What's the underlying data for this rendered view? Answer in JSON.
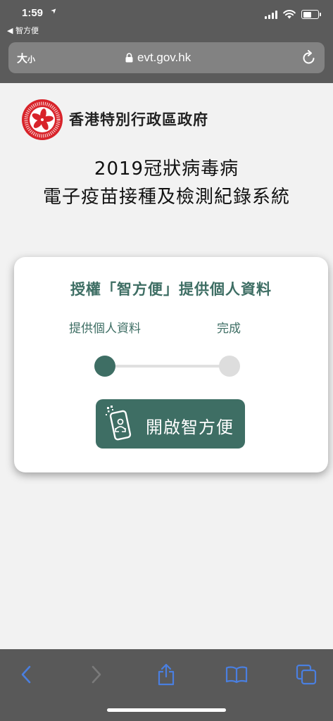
{
  "status_bar": {
    "time": "1:59",
    "location_arrow": "➤",
    "back_app": "◀ 智方便"
  },
  "browser": {
    "text_size_big": "大",
    "text_size_small": "小",
    "url": "evt.gov.hk"
  },
  "page": {
    "gov_name": "香港特別行政區政府",
    "title_line1": "2019冠狀病毒病",
    "title_line2": "電子疫苗接種及檢測紀錄系統"
  },
  "card": {
    "title": "授權「智方便」提供個人資料",
    "steps": [
      {
        "label": "提供個人資料",
        "state": "active"
      },
      {
        "label": "完成",
        "state": "inactive"
      }
    ],
    "button_label": "開啟智方便"
  },
  "colors": {
    "brand_green": "#3e6e64",
    "toolbar_blue": "#4a7fe0",
    "emblem_red": "#d8232a"
  },
  "icons": {
    "signal": "signal-icon",
    "wifi": "wifi-icon",
    "battery": "battery-icon",
    "lock": "lock-icon",
    "reload": "reload-icon",
    "back": "chevron-left-icon",
    "forward": "chevron-right-icon",
    "share": "share-icon",
    "bookmarks": "book-icon",
    "tabs": "tabs-icon",
    "iamsmart": "iamsmart-phone-icon",
    "emblem": "hksar-emblem-icon"
  }
}
